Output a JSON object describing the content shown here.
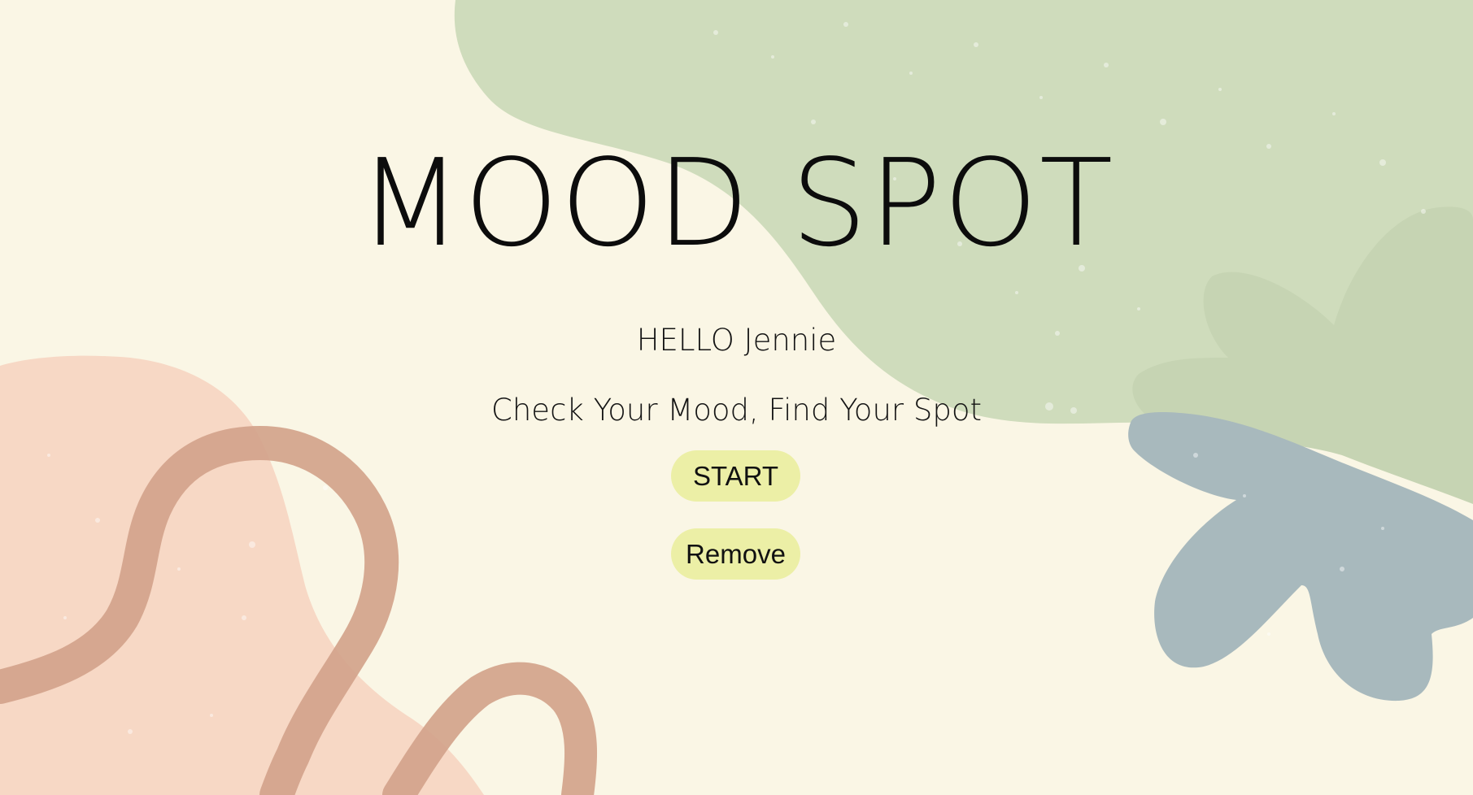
{
  "app": {
    "title": "MOOD SPOT",
    "greeting": "HELLO Jennie",
    "tagline": "Check Your Mood, Find Your Spot"
  },
  "buttons": {
    "start_label": "START",
    "remove_label": "Remove"
  },
  "colors": {
    "background": "#faf6e5",
    "green_blob": "#cfdcbc",
    "peach_blob": "#f7d8c5",
    "brown_squiggle": "#d2a38b",
    "blue_flower": "#a8b9bd",
    "button": "#ecefa6"
  },
  "icons": {
    "decorations": [
      "green-blob",
      "peach-blob",
      "brown-squiggle",
      "blue-flower"
    ]
  }
}
